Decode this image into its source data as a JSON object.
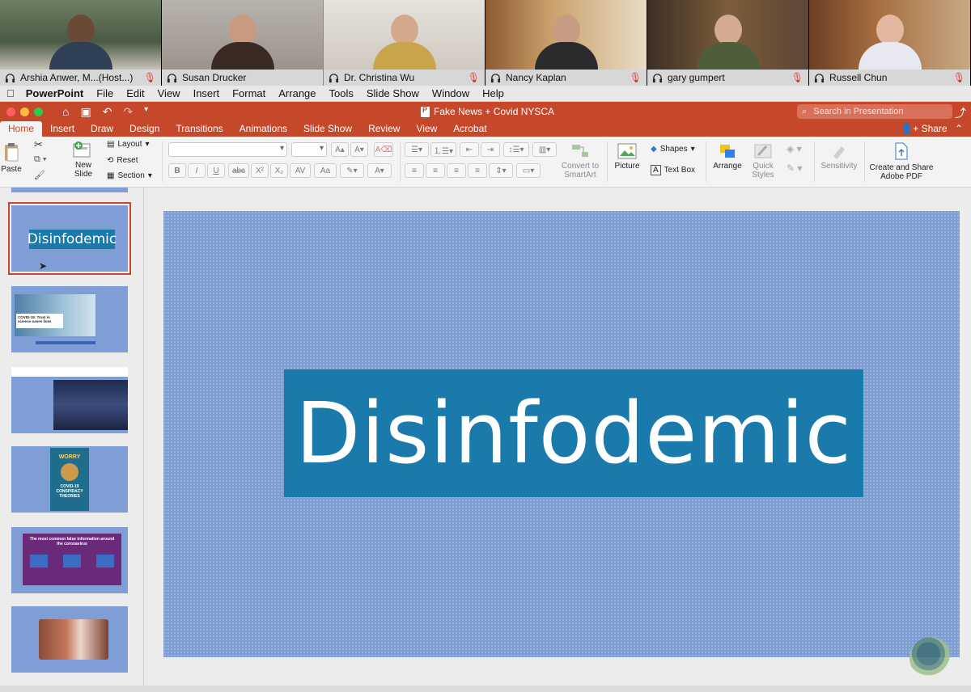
{
  "zoom": {
    "participants": [
      {
        "name": "Arshia Anwer, M...(Host...)",
        "muted": true,
        "active": false
      },
      {
        "name": "Susan Drucker",
        "muted": false,
        "active": true
      },
      {
        "name": "Dr. Christina Wu",
        "muted": true,
        "active": false
      },
      {
        "name": "Nancy Kaplan",
        "muted": true,
        "active": false
      },
      {
        "name": "gary gumpert",
        "muted": true,
        "active": false
      },
      {
        "name": "Russell Chun",
        "muted": true,
        "active": false
      }
    ]
  },
  "menubar": {
    "app": "PowerPoint",
    "items": [
      "File",
      "Edit",
      "View",
      "Insert",
      "Format",
      "Arrange",
      "Tools",
      "Slide Show",
      "Window",
      "Help"
    ]
  },
  "titlebar": {
    "doc_title": "Fake News + Covid NYSCA",
    "search_placeholder": "Search in Presentation"
  },
  "ribbon": {
    "tabs": [
      "Home",
      "Insert",
      "Draw",
      "Design",
      "Transitions",
      "Animations",
      "Slide Show",
      "Review",
      "View",
      "Acrobat"
    ],
    "active_tab": "Home",
    "share_label": "Share",
    "paste": "Paste",
    "new_slide": "New Slide",
    "layout": "Layout",
    "reset": "Reset",
    "section": "Section",
    "convert_smartart": "Convert to SmartArt",
    "picture": "Picture",
    "shapes": "Shapes",
    "text_box": "Text Box",
    "arrange": "Arrange",
    "quick_styles": "Quick Styles",
    "sensitivity": "Sensitivity",
    "create_share_pdf": "Create and Share Adobe PDF"
  },
  "slide": {
    "title": "Disinfodemic"
  },
  "thumbnails": {
    "selected_title": "Disinfodemic",
    "t2_caption": "COVID-19: Trust in science saves lives",
    "t4_line1": "WORRY",
    "t4_line2": "COVID-19 CONSPIRACY THEORIES",
    "t5_caption": "The most common false information around the coronavirus"
  },
  "colors": {
    "ppt_orange": "#c5482a",
    "slide_bg": "#7e9ed4",
    "title_band": "#1a7aab",
    "active_speaker": "#2aa7e8"
  }
}
